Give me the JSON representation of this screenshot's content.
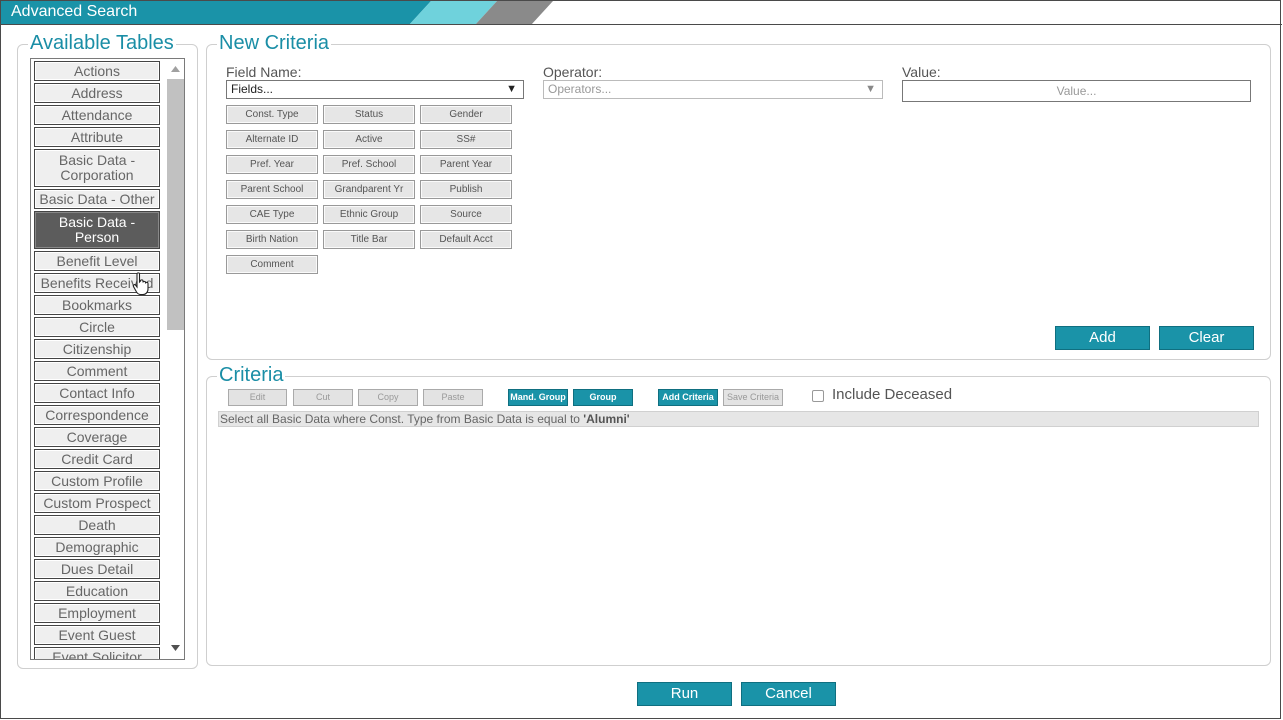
{
  "window": {
    "title": "Advanced Search",
    "accent": "#1a93a8"
  },
  "available_tables": {
    "legend": "Available Tables",
    "selected": "Basic Data - Person",
    "items": [
      {
        "label": "Actions"
      },
      {
        "label": "Address"
      },
      {
        "label": "Attendance"
      },
      {
        "label": "Attribute"
      },
      {
        "label": "Basic Data - Corporation"
      },
      {
        "label": "Basic Data - Other"
      },
      {
        "label": "Basic Data - Person"
      },
      {
        "label": "Benefit Level"
      },
      {
        "label": "Benefits Received"
      },
      {
        "label": "Bookmarks"
      },
      {
        "label": "Circle"
      },
      {
        "label": "Citizenship"
      },
      {
        "label": "Comment"
      },
      {
        "label": "Contact Info"
      },
      {
        "label": "Correspondence"
      },
      {
        "label": "Coverage"
      },
      {
        "label": "Credit Card"
      },
      {
        "label": "Custom Profile"
      },
      {
        "label": "Custom Prospect"
      },
      {
        "label": "Death"
      },
      {
        "label": "Demographic"
      },
      {
        "label": "Dues Detail"
      },
      {
        "label": "Education"
      },
      {
        "label": "Employment"
      },
      {
        "label": "Event Guest"
      },
      {
        "label": "Event Solicitor"
      }
    ]
  },
  "new_criteria": {
    "legend": "New Criteria",
    "field_name_label": "Field Name:",
    "field_name_value": "Fields...",
    "operator_label": "Operator:",
    "operator_value": "Operators...",
    "value_label": "Value:",
    "value_placeholder": "Value...",
    "field_buttons": [
      [
        "Const. Type",
        "Status",
        "Gender"
      ],
      [
        "Alternate ID",
        "Active",
        "SS#"
      ],
      [
        "Pref. Year",
        "Pref. School",
        "Parent Year"
      ],
      [
        "Parent School",
        "Grandparent Yr",
        "Publish"
      ],
      [
        "CAE Type",
        "Ethnic Group",
        "Source"
      ],
      [
        "Birth Nation",
        "Title Bar",
        "Default Acct"
      ],
      [
        "Comment"
      ]
    ],
    "add_label": "Add",
    "clear_label": "Clear"
  },
  "criteria": {
    "legend": "Criteria",
    "toolbar": {
      "edit": "Edit",
      "cut": "Cut",
      "copy": "Copy",
      "paste": "Paste",
      "mand_group": "Mand. Group",
      "group": "Group",
      "add_criteria": "Add Criteria",
      "save_criteria": "Save Criteria"
    },
    "include_deceased_label": "Include Deceased",
    "include_deceased_checked": false,
    "statement_prefix": "Select all Basic Data where Const. Type from Basic Data is equal to ",
    "statement_value": "'Alumni'"
  },
  "footer": {
    "run_label": "Run",
    "cancel_label": "Cancel"
  }
}
